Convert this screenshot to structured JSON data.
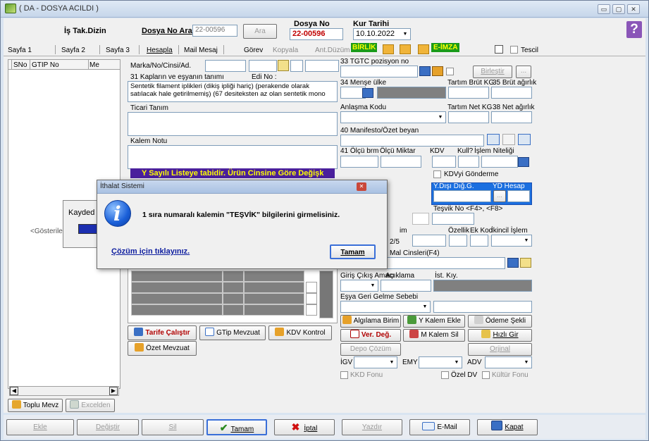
{
  "window": {
    "title": "( DA - DOSYA ACILDI )",
    "min": "▭",
    "max": "▢",
    "close": "✕"
  },
  "header": {
    "is_tak": "İş Tak.Dizin",
    "dosya_no_ara": "Dosya No Ara",
    "dosya_no_value": "22-00596",
    "ara_btn": "Ara",
    "dosya_no_label": "Dosya No",
    "dosya_no_big": "22-00596",
    "kur_tarihi_label": "Kur Tarihi",
    "kur_tarihi_value": "10.10.2022",
    "help": "?"
  },
  "tabs": {
    "sayfa1": "Sayfa 1",
    "sayfa2": "Sayfa 2",
    "sayfa3": "Sayfa 3",
    "hesapla": "Hesapla",
    "mail": "Mail Mesaj",
    "gorev": "Görev",
    "kopyala": "Kopyala",
    "ant": "Ant.Düzüm",
    "birlik": "BİRLİK",
    "eimza": "E-İMZA",
    "tescil": "Tescil"
  },
  "list": {
    "col_sno": "SNo",
    "col_gtip": "GTIP No",
    "col_me": "Me",
    "kayded": "Kayded",
    "gosterilece": "<Gösterilece",
    "toplu": "Toplu Mevz",
    "excelden": "Excelden"
  },
  "mid": {
    "marka": "Marka/No/Cinsi/Ad.",
    "kaplar": "31 Kapların ve eşyanın tanımı",
    "edi": "Edi No :",
    "tanim_text": "Sentetik filament iplikleri (dikiş ipliği hariç) (perakende olarak satılacak hale getirilmemiş) (67 desiteksten az olan sentetik mono",
    "ticari": "Ticari Tanım",
    "kalem_notu": "Kalem Notu",
    "banner": "Y Sayılı Listeye tabidir. Ürün Cinsine Göre Değişk",
    "tarife": "Tarife Çalıştır",
    "gtip_mevzuat": "GTip Mevzuat",
    "kdv_kontrol": "KDV Kontrol",
    "ozet_mevzuat": "Özet Mevzuat"
  },
  "right": {
    "tgtc": "33 TGTC pozisyon no",
    "birlestir": "Birleştir",
    "dots": "...",
    "mense": "34 Menşe ülke",
    "tartim_brut": "Tartım Brüt KG",
    "brut": "35 Brüt ağırlık",
    "anlasma": "Anlaşma Kodu",
    "tartim_net": "Tartım Net KG",
    "net": "38 Net ağırlık",
    "manifesto": "40 Manifesto/Özet beyan",
    "olcu_brm": "41 Ölçü brm",
    "olcu_miktar": "Ölçü Miktar",
    "kdv": "KDV",
    "kull": "Kull?",
    "islem_nit": "İşlem Niteliği",
    "kdvyi": "KDVyi Gönderme",
    "ydisi": "Y.Dışı Dığ.G.",
    "yd_hesap": "YD Hesap",
    "tesvik": "Teşvik No <F4>, <F8>",
    "im": "im",
    "ozellik": "Özellik",
    "ek_kod": "Ek Kod",
    "ikincil": "İkincil İşlem",
    "frac": "2/5",
    "mal_cinsleri": "Mal Cinsleri(F4)",
    "giris_cikis": "Giriş Çıkış Amacı",
    "aciklama": "Açıklama",
    "ist_kiy": "İst. Kıy.",
    "esya_geri": "Eşya Geri Gelme Sebebi",
    "algilama": "Algılama Birim",
    "y_kalem_ekle": "Y Kalem Ekle",
    "odeme": "Ödeme Şekli",
    "ver_deg": "Ver. Değ.",
    "m_kalem_sil": "M Kalem Sil",
    "hizli_gir": "Hızlı Gir",
    "depo": "Depo Çözüm",
    "orjinal": "Orjinal",
    "igv": "İGV",
    "emy": "EMY",
    "adv": "ADV",
    "kkd": "KKD Fonu",
    "ozel_dv": "Özel DV",
    "kultur": "Kültür Fonu"
  },
  "dialog": {
    "title": "İthalat Sistemi",
    "message": "1 sıra numaralı kalemin \"TEŞVİK\" bilgilerini girmelisiniz.",
    "link": "Çözüm için tıklayınız.",
    "ok": "Tamam",
    "close": "✕"
  },
  "bottom": {
    "ekle": "Ekle",
    "degistir": "Değiştir",
    "sil": "Sil",
    "tamam": "Tamam",
    "iptal": "İptal",
    "yazdir": "Yazdır",
    "email": "E-Mail",
    "kapat": "Kapat"
  }
}
